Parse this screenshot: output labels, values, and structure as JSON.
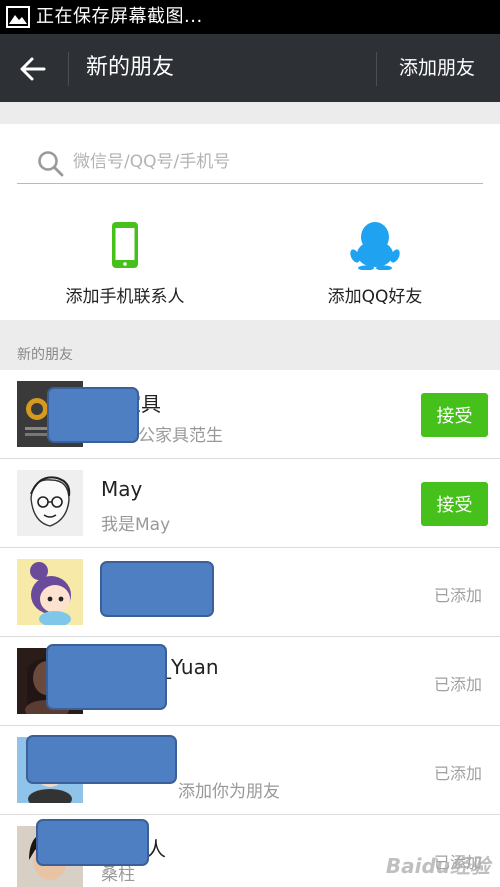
{
  "status_bar": {
    "text": "正在保存屏幕截图..."
  },
  "nav": {
    "title": "新的朋友",
    "action_label": "添加朋友"
  },
  "search": {
    "placeholder": "微信号/QQ号/手机号"
  },
  "quick_actions": [
    {
      "label": "添加手机联系人",
      "icon": "phone-icon",
      "color": "#46c01b"
    },
    {
      "label": "添加QQ好友",
      "icon": "qq-penguin-icon",
      "color": "#1fa3f0"
    }
  ],
  "section_title": "新的朋友",
  "friends": [
    {
      "name": "家具",
      "message": "办公家具范生",
      "status": "接受"
    },
    {
      "name": "May",
      "message": "我是May",
      "status": "接受"
    },
    {
      "name": "",
      "message": "",
      "status": "已添加"
    },
    {
      "name": "_Yuan",
      "message": "",
      "status": "已添加"
    },
    {
      "name": "",
      "message": "添加你为朋友",
      "status": "已添加"
    },
    {
      "name": "人",
      "message": "桑柱",
      "status": "已添加"
    }
  ],
  "watermark": "Baidu经验",
  "colors": {
    "accept_green": "#46c01b",
    "nav_bg": "#2d3035",
    "redaction_blue": "#4f7fc3"
  }
}
